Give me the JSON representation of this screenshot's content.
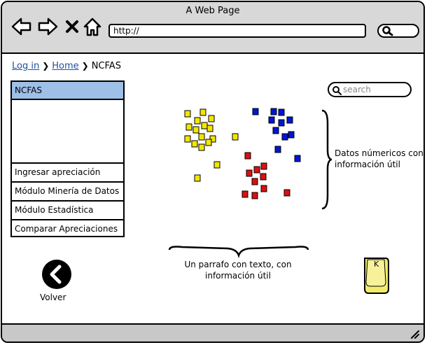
{
  "window": {
    "title": "A Web Page"
  },
  "toolbar": {
    "url": "http://"
  },
  "breadcrumb": {
    "login": "Log in",
    "home": "Home",
    "current": "NCFAS",
    "separator": "❯"
  },
  "sidebar": {
    "active": "NCFAS",
    "items": [
      {
        "label": "Ingresar apreciación"
      },
      {
        "label": "Módulo Minería de Datos"
      },
      {
        "label": "Módulo Estadística"
      },
      {
        "label": "Comparar Apreciaciones"
      }
    ]
  },
  "search": {
    "placeholder": "search"
  },
  "annotations": {
    "datos_line1": "Datos númericos con",
    "datos_line2": "información útil",
    "parrafo_line1": "Un parrafo con texto, con",
    "parrafo_line2": "información útil"
  },
  "back": {
    "label": "Volver"
  },
  "sticky": {
    "label": "K"
  },
  "colors": {
    "yellow": "#f2e600",
    "blue": "#0015d6",
    "red": "#dd0f0f",
    "highlight": "#9dbfe8",
    "sticky": "#f2ec6a"
  }
}
